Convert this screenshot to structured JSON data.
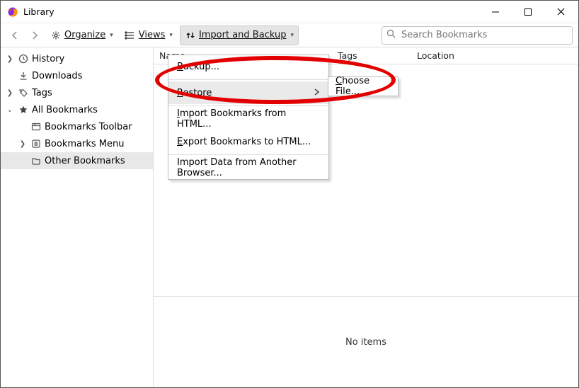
{
  "window": {
    "title": "Library"
  },
  "toolbar": {
    "organize": "Organize",
    "views": "Views",
    "import_backup": "Import and Backup",
    "search_placeholder": "Search Bookmarks"
  },
  "sidebar": {
    "history": "History",
    "downloads": "Downloads",
    "tags": "Tags",
    "all_bookmarks": "All Bookmarks",
    "bookmarks_toolbar": "Bookmarks Toolbar",
    "bookmarks_menu": "Bookmarks Menu",
    "other_bookmarks": "Other Bookmarks"
  },
  "columns": {
    "name": "Name",
    "tags": "Tags",
    "location": "Location"
  },
  "menu": {
    "backup": "Backup...",
    "restore": "Restore",
    "import_html": "Import Bookmarks from HTML...",
    "export_html": "Export Bookmarks to HTML...",
    "import_browser": "Import Data from Another Browser..."
  },
  "submenu": {
    "choose_file": "Choose File..."
  },
  "content": {
    "no_items": "No items"
  }
}
